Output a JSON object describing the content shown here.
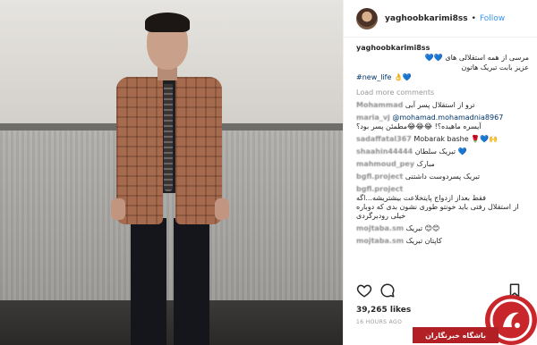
{
  "header": {
    "username": "yaghoobkarimi8ss",
    "separator": "•",
    "follow_label": "Follow"
  },
  "caption": {
    "username": "yaghoobkarimi8ss",
    "line1": "مرسی از همه استقلالی های 💙💙",
    "line2": "عزیز بابت تبریک هاتون",
    "hashtag": "#new_life 👌💙"
  },
  "load_more": "Load more comments",
  "comments": [
    {
      "user": "Mohammad",
      "text": "ترو از استقلال پسر آبی"
    },
    {
      "user": "maria_vj",
      "text": "@mohamad.mohamadnia8967"
    },
    {
      "user": "",
      "text": "آیسره ماهیده؟! 😂😂😂مطمئن پسر بود؟"
    },
    {
      "user": "sadaffatal367",
      "text": "Mobarak bashe 🌹💙🙌"
    },
    {
      "user": "shaahin44444",
      "text": "تبریک سلطان 💙"
    },
    {
      "user": "mahmoud_pey",
      "text": "مبارک"
    },
    {
      "user": "bgfl.project",
      "text": "تبریک پسردوست داشتنی"
    },
    {
      "user": "bgfl.project",
      "text": "فقط بعداز ازدواج پایتخلاعت بیشتریشه...اگه"
    },
    {
      "user": "",
      "text": "از استقلال رفتی باید خونتو طوری نشون بدی که دوباره"
    },
    {
      "user": "",
      "text": "خیلی رودبرگردی"
    },
    {
      "user": "mojtaba.sm",
      "text": "تبریک 😊😊"
    },
    {
      "user": "mojtaba.sm",
      "text": "کاپتان تبریک"
    }
  ],
  "likes": "39,265 likes",
  "time_ago": "16 HOURS AGO",
  "watermark": {
    "text": "باشگاه خبرنگاران"
  },
  "icons": {
    "heart": "heart-icon",
    "comment": "comment-icon",
    "bookmark": "bookmark-icon",
    "watermark_logo": "news-logo-icon"
  },
  "colors": {
    "follow": "#3897f0",
    "hashtag": "#003569",
    "watermark": "#c8262b"
  }
}
